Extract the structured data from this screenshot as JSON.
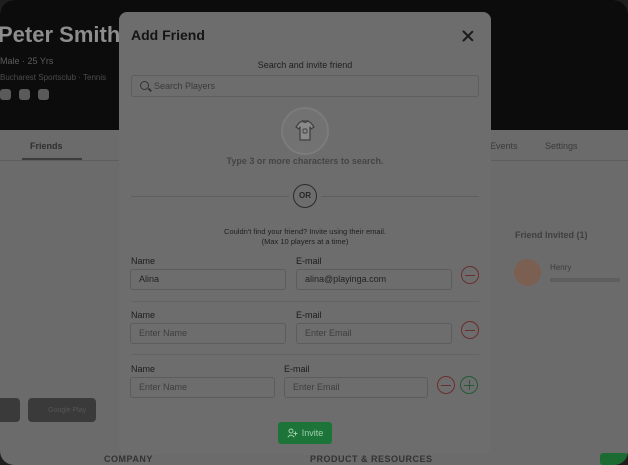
{
  "background": {
    "profile_name": "Peter Smith",
    "profile_meta": "Male · 25 Yrs",
    "profile_sub": "Bucharest Sportsclub · Tennis",
    "tabs": [
      "Friends",
      "Events",
      "Settings"
    ],
    "right_title": "Friend Invited (1)",
    "right_friend_name": "Henry",
    "footer_left": "COMPANY",
    "footer_right": "PRODUCT & RESOURCES",
    "store_label": "Google Play"
  },
  "modal": {
    "title": "Add Friend",
    "subtitle": "Search and invite friend",
    "search_placeholder": "Search Players",
    "hint": "Type 3 or more characters to search.",
    "or_label": "OR",
    "invite_note_line1": "Couldn't find your friend? Invite using their email.",
    "invite_note_line2": "(Max 10 players at a time)",
    "name_label": "Name",
    "email_label": "E-mail",
    "name_placeholder": "Enter Name",
    "email_placeholder": "Enter Email",
    "rows": [
      {
        "name": "Alina",
        "email": "alina@playinga.com"
      },
      {
        "name": "",
        "email": ""
      },
      {
        "name": "",
        "email": ""
      }
    ],
    "invite_button": "Invite"
  },
  "colors": {
    "accent_green": "#1d7438",
    "remove_red": "#6a2e2e",
    "overlay": "#6b6b6b"
  },
  "icons": [
    "search-icon",
    "shirt-icon",
    "close-icon",
    "minus-icon",
    "plus-icon",
    "add-user-icon"
  ]
}
